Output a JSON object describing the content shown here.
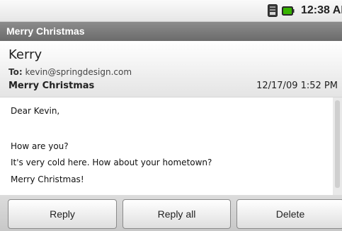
{
  "status_bar": {
    "time": "12:38 AM",
    "icons": [
      "sim-card-icon",
      "battery-icon"
    ],
    "battery_color": "#37b400"
  },
  "title_bar": {
    "title": "Merry Christmas"
  },
  "message": {
    "sender": "Kerry",
    "to_label": "To:",
    "to_address": "kevin@springdesign.com",
    "subject": "Merry Christmas",
    "date": "12/17/09 1:52 PM",
    "body_lines": [
      "Dear Kevin,",
      "",
      "How are you?",
      "It's very cold here. How about your hometown?",
      "Merry Christmas!"
    ]
  },
  "buttons": {
    "reply": "Reply",
    "reply_all": "Reply all",
    "delete": "Delete"
  }
}
